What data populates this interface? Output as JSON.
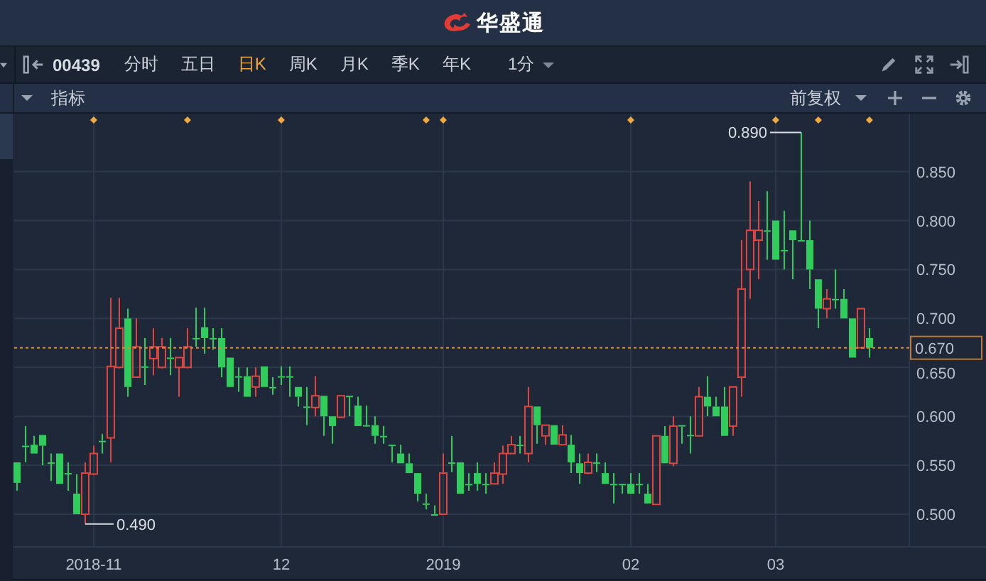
{
  "header": {
    "brand": "华盛通"
  },
  "toolbar": {
    "symbol": "00439",
    "tabs": [
      {
        "label": "分时",
        "selected": false
      },
      {
        "label": "五日",
        "selected": false
      },
      {
        "label": "日K",
        "selected": true
      },
      {
        "label": "周K",
        "selected": false
      },
      {
        "label": "月K",
        "selected": false
      },
      {
        "label": "季K",
        "selected": false
      },
      {
        "label": "年K",
        "selected": false
      }
    ],
    "interval": "1分"
  },
  "indicator_bar": {
    "label": "指标",
    "adjustment": "前复权"
  },
  "chart": {
    "chart_data": {
      "type": "candlestick",
      "grid": true,
      "ylim": [
        0.4666,
        0.9092
      ],
      "yticks": [
        {
          "value": 0.5,
          "label": "0.500"
        },
        {
          "value": 0.55,
          "label": "0.550"
        },
        {
          "value": 0.6,
          "label": "0.600"
        },
        {
          "value": 0.65,
          "label": "0.650"
        },
        {
          "value": 0.7,
          "label": "0.700"
        },
        {
          "value": 0.75,
          "label": "0.750"
        },
        {
          "value": 0.8,
          "label": "0.800"
        },
        {
          "value": 0.85,
          "label": "0.850"
        }
      ],
      "categories": [
        null,
        null,
        null,
        null,
        null,
        null,
        null,
        null,
        null,
        "2018-11",
        null,
        null,
        null,
        null,
        null,
        null,
        null,
        null,
        null,
        null,
        null,
        null,
        null,
        null,
        null,
        null,
        null,
        null,
        null,
        null,
        null,
        "12",
        null,
        null,
        null,
        null,
        null,
        null,
        null,
        null,
        null,
        null,
        null,
        null,
        null,
        null,
        null,
        null,
        null,
        null,
        "2019",
        null,
        null,
        null,
        null,
        null,
        null,
        null,
        null,
        null,
        null,
        null,
        null,
        null,
        null,
        null,
        null,
        null,
        null,
        null,
        null,
        null,
        "02",
        null,
        null,
        null,
        null,
        null,
        null,
        null,
        null,
        null,
        null,
        null,
        null,
        null,
        null,
        null,
        null,
        "03",
        null,
        null,
        null,
        null,
        null,
        null,
        null,
        null,
        null,
        null,
        null
      ],
      "ohlc": [
        [
          0.553,
          0.553,
          0.524,
          0.532
        ],
        [
          0.57,
          0.59,
          0.553,
          0.57
        ],
        [
          0.571,
          0.58,
          0.562,
          0.562
        ],
        [
          0.581,
          0.581,
          0.55,
          0.57
        ],
        [
          0.553,
          0.562,
          0.534,
          0.552
        ],
        [
          0.562,
          0.562,
          0.531,
          0.531
        ],
        [
          0.542,
          0.553,
          0.524,
          0.541
        ],
        [
          0.521,
          0.541,
          0.5,
          0.5
        ],
        [
          0.5,
          0.553,
          0.49,
          0.542
        ],
        [
          0.541,
          0.57,
          0.54,
          0.562
        ],
        [
          0.575,
          0.582,
          0.562,
          0.575
        ],
        [
          0.578,
          0.721,
          0.553,
          0.651
        ],
        [
          0.65,
          0.721,
          0.649,
          0.69
        ],
        [
          0.7,
          0.71,
          0.62,
          0.63
        ],
        [
          0.64,
          0.7,
          0.64,
          0.671
        ],
        [
          0.651,
          0.68,
          0.632,
          0.651
        ],
        [
          0.659,
          0.69,
          0.642,
          0.671
        ],
        [
          0.65,
          0.68,
          0.649,
          0.671
        ],
        [
          0.66,
          0.68,
          0.642,
          0.66
        ],
        [
          0.65,
          0.66,
          0.62,
          0.66
        ],
        [
          0.65,
          0.69,
          0.649,
          0.671
        ],
        [
          0.68,
          0.711,
          0.671,
          0.68
        ],
        [
          0.691,
          0.711,
          0.664,
          0.68
        ],
        [
          0.68,
          0.69,
          0.668,
          0.68
        ],
        [
          0.68,
          0.69,
          0.64,
          0.65
        ],
        [
          0.66,
          0.66,
          0.63,
          0.63
        ],
        [
          0.641,
          0.65,
          0.625,
          0.641
        ],
        [
          0.641,
          0.65,
          0.62,
          0.62
        ],
        [
          0.63,
          0.65,
          0.62,
          0.641
        ],
        [
          0.651,
          0.651,
          0.63,
          0.63
        ],
        [
          0.63,
          0.64,
          0.622,
          0.63
        ],
        [
          0.641,
          0.651,
          0.632,
          0.641
        ],
        [
          0.641,
          0.651,
          0.62,
          0.641
        ],
        [
          0.63,
          0.63,
          0.61,
          0.62
        ],
        [
          0.61,
          0.63,
          0.591,
          0.61
        ],
        [
          0.609,
          0.641,
          0.6,
          0.621
        ],
        [
          0.621,
          0.621,
          0.58,
          0.6
        ],
        [
          0.6,
          0.6,
          0.572,
          0.59
        ],
        [
          0.599,
          0.621,
          0.599,
          0.621
        ],
        [
          0.621,
          0.621,
          0.6,
          0.621
        ],
        [
          0.611,
          0.62,
          0.59,
          0.59
        ],
        [
          0.591,
          0.611,
          0.59,
          0.591
        ],
        [
          0.591,
          0.6,
          0.572,
          0.58
        ],
        [
          0.58,
          0.59,
          0.572,
          0.58
        ],
        [
          0.571,
          0.571,
          0.553,
          0.571
        ],
        [
          0.562,
          0.571,
          0.552,
          0.552
        ],
        [
          0.552,
          0.562,
          0.542,
          0.542
        ],
        [
          0.542,
          0.542,
          0.513,
          0.521
        ],
        [
          0.511,
          0.521,
          0.505,
          0.511
        ],
        [
          0.5,
          0.509,
          0.5,
          0.5
        ],
        [
          0.5,
          0.562,
          0.5,
          0.542
        ],
        [
          0.553,
          0.58,
          0.543,
          0.553
        ],
        [
          0.553,
          0.553,
          0.521,
          0.521
        ],
        [
          0.531,
          0.542,
          0.524,
          0.531
        ],
        [
          0.542,
          0.553,
          0.524,
          0.531
        ],
        [
          0.531,
          0.542,
          0.521,
          0.531
        ],
        [
          0.531,
          0.553,
          0.531,
          0.542
        ],
        [
          0.541,
          0.57,
          0.531,
          0.562
        ],
        [
          0.562,
          0.58,
          0.562,
          0.571
        ],
        [
          0.571,
          0.58,
          0.562,
          0.571
        ],
        [
          0.562,
          0.63,
          0.553,
          0.61
        ],
        [
          0.61,
          0.61,
          0.572,
          0.591
        ],
        [
          0.58,
          0.591,
          0.571,
          0.591
        ],
        [
          0.591,
          0.591,
          0.571,
          0.571
        ],
        [
          0.571,
          0.591,
          0.571,
          0.581
        ],
        [
          0.571,
          0.581,
          0.542,
          0.553
        ],
        [
          0.552,
          0.562,
          0.531,
          0.542
        ],
        [
          0.542,
          0.562,
          0.541,
          0.553
        ],
        [
          0.553,
          0.562,
          0.543,
          0.553
        ],
        [
          0.542,
          0.553,
          0.531,
          0.531
        ],
        [
          0.531,
          0.542,
          0.511,
          0.531
        ],
        [
          0.531,
          0.531,
          0.521,
          0.531
        ],
        [
          0.531,
          0.542,
          0.521,
          0.521
        ],
        [
          0.531,
          0.542,
          0.521,
          0.531
        ],
        [
          0.521,
          0.531,
          0.511,
          0.511
        ],
        [
          0.51,
          0.58,
          0.51,
          0.58
        ],
        [
          0.58,
          0.59,
          0.552,
          0.552
        ],
        [
          0.552,
          0.6,
          0.549,
          0.59
        ],
        [
          0.591,
          0.591,
          0.572,
          0.591
        ],
        [
          0.581,
          0.6,
          0.562,
          0.581
        ],
        [
          0.58,
          0.63,
          0.58,
          0.62
        ],
        [
          0.62,
          0.641,
          0.6,
          0.61
        ],
        [
          0.61,
          0.62,
          0.6,
          0.6
        ],
        [
          0.61,
          0.63,
          0.58,
          0.58
        ],
        [
          0.59,
          0.63,
          0.58,
          0.63
        ],
        [
          0.64,
          0.78,
          0.62,
          0.73
        ],
        [
          0.75,
          0.84,
          0.72,
          0.79
        ],
        [
          0.78,
          0.82,
          0.74,
          0.79
        ],
        [
          0.79,
          0.83,
          0.76,
          0.79
        ],
        [
          0.8,
          0.8,
          0.76,
          0.76
        ],
        [
          0.77,
          0.81,
          0.75,
          0.77
        ],
        [
          0.79,
          0.79,
          0.74,
          0.78
        ],
        [
          0.78,
          0.89,
          0.78,
          0.78
        ],
        [
          0.78,
          0.8,
          0.73,
          0.75
        ],
        [
          0.74,
          0.74,
          0.69,
          0.71
        ],
        [
          0.71,
          0.73,
          0.7,
          0.72
        ],
        [
          0.72,
          0.75,
          0.71,
          0.72
        ],
        [
          0.72,
          0.73,
          0.7,
          0.7
        ],
        [
          0.7,
          0.7,
          0.66,
          0.66
        ],
        [
          0.67,
          0.71,
          0.67,
          0.71
        ],
        [
          0.68,
          0.69,
          0.66,
          0.67
        ]
      ],
      "annotations": [
        "0.890",
        "0.490"
      ],
      "ref_lines": [
        {
          "axis": "y",
          "value": 0.67,
          "label": "0.670"
        }
      ]
    }
  }
}
